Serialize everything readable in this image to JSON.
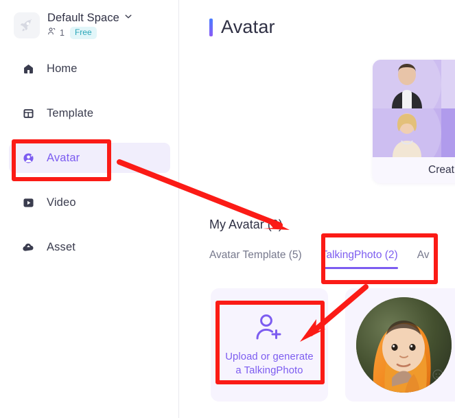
{
  "sidebar": {
    "workspace": {
      "logo_icon": "rocket-icon",
      "name": "Default Space",
      "chevron_icon": "chevron-down-icon",
      "member_icon": "members-icon",
      "member_count": "1",
      "plan_badge": "Free"
    },
    "items": [
      {
        "label": "Home",
        "icon": "home-icon",
        "active": false
      },
      {
        "label": "Template",
        "icon": "template-icon",
        "active": false
      },
      {
        "label": "Avatar",
        "icon": "avatar-icon",
        "active": true
      },
      {
        "label": "Video",
        "icon": "video-icon",
        "active": false
      },
      {
        "label": "Asset",
        "icon": "asset-icon",
        "active": false
      }
    ]
  },
  "main": {
    "page_title": "Avatar",
    "promo_card": {
      "footer_label": "Creat"
    },
    "section": {
      "heading": "My Avatar (9)",
      "tabs": [
        {
          "label": "Avatar Template (5)",
          "active": false
        },
        {
          "label": "TalkingPhoto (2)",
          "active": true
        },
        {
          "label": "Av",
          "active": false
        }
      ]
    },
    "cards": {
      "upload": {
        "icon": "user-plus-icon",
        "label_line1": "Upload or generate",
        "label_line2": "a TalkingPhoto"
      },
      "photo": {
        "alt_name": "talkingphoto-thumbnail"
      }
    }
  },
  "annotations": {
    "color": "#fb1b16",
    "boxes": [
      {
        "name": "highlight-box-avatar-nav"
      },
      {
        "name": "highlight-box-talkingphoto-tab"
      },
      {
        "name": "highlight-box-upload-card"
      }
    ],
    "arrows": [
      {
        "name": "arrow-avatar-nav-to-my-avatar"
      },
      {
        "name": "arrow-talkingphoto-tab-to-upload-card"
      }
    ]
  },
  "colors": {
    "accent_purple": "#7c5cf0",
    "accent_blue": "#4a7dff",
    "active_nav_bg": "#f1eefc",
    "badge_bg": "#e2f6f9",
    "badge_text": "#2aa6b8",
    "annotation_red": "#fb1b16"
  }
}
